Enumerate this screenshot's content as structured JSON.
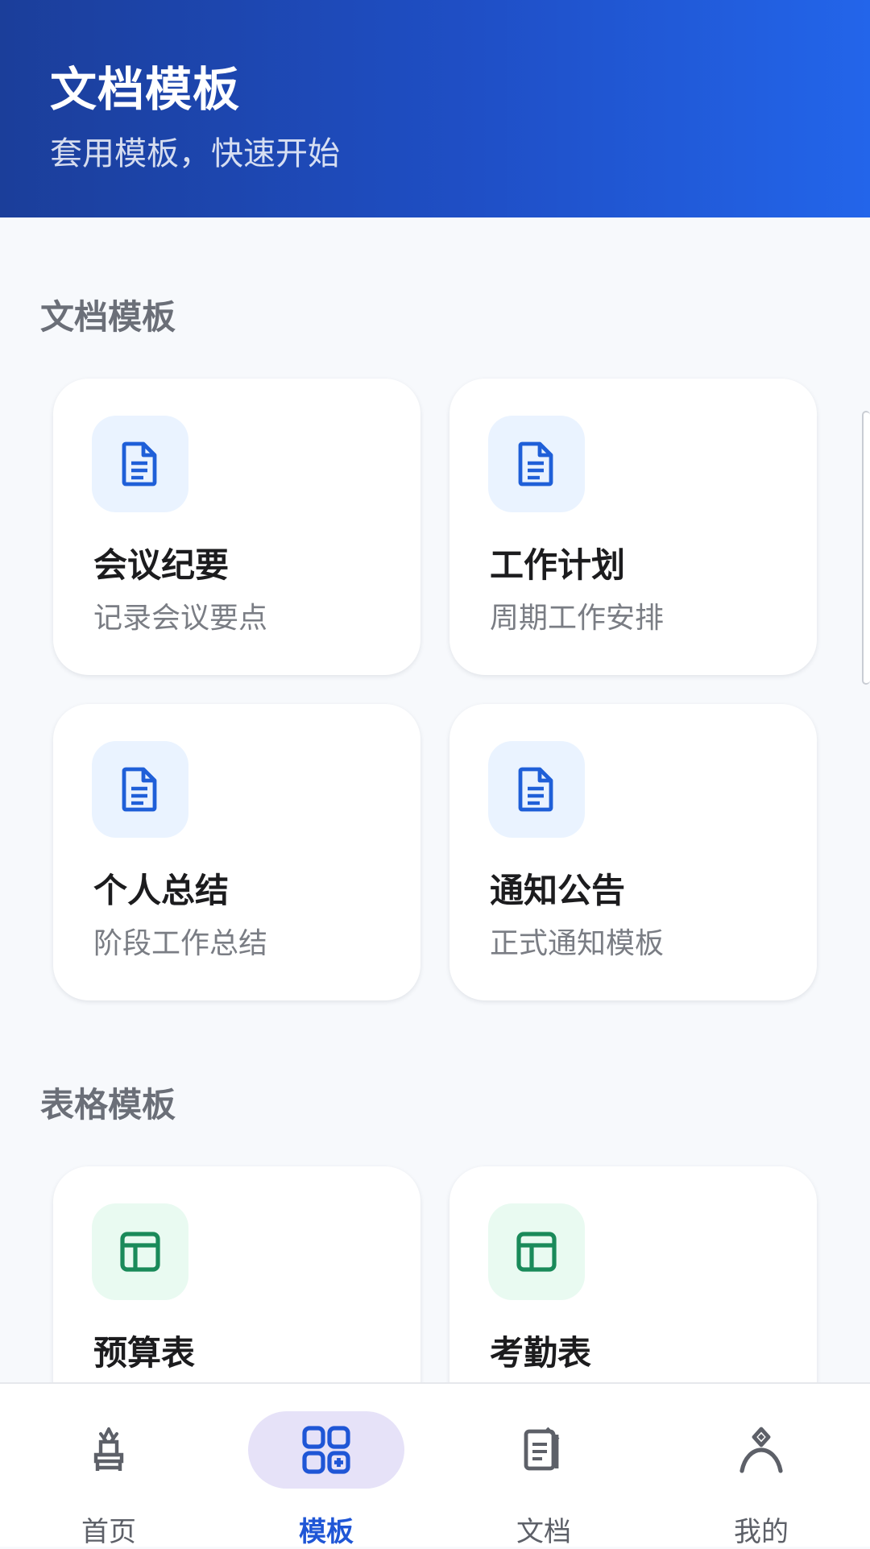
{
  "header": {
    "title": "文档模板",
    "subtitle": "套用模板，快速开始"
  },
  "sections": [
    {
      "title": "文档模板",
      "cards": [
        {
          "title": "会议纪要",
          "desc": "记录会议要点",
          "icon": "document-icon"
        },
        {
          "title": "工作计划",
          "desc": "周期工作安排",
          "icon": "document-icon"
        },
        {
          "title": "个人总结",
          "desc": "阶段工作总结",
          "icon": "document-icon"
        },
        {
          "title": "通知公告",
          "desc": "正式通知模板",
          "icon": "document-icon"
        }
      ]
    },
    {
      "title": "表格模板",
      "cards": [
        {
          "title": "预算表",
          "desc": "",
          "icon": "table-icon"
        },
        {
          "title": "考勤表",
          "desc": "",
          "icon": "table-icon"
        }
      ]
    }
  ],
  "bottom_nav": {
    "items": [
      {
        "label": "首页",
        "icon": "home-icon",
        "active": false
      },
      {
        "label": "模板",
        "icon": "template-grid-icon",
        "active": true
      },
      {
        "label": "文档",
        "icon": "documents-icon",
        "active": false
      },
      {
        "label": "我的",
        "icon": "profile-icon",
        "active": false
      }
    ]
  },
  "colors": {
    "header_gradient_start": "#1b3e9a",
    "header_gradient_end": "#2365ea",
    "doc_icon": "#1f5fd8",
    "doc_icon_bg": "#eaf3ff",
    "sheet_icon": "#1a8a5a",
    "sheet_icon_bg": "#e9faf1",
    "nav_active": "#1f56d6",
    "nav_active_bg": "#e6e2f8"
  }
}
